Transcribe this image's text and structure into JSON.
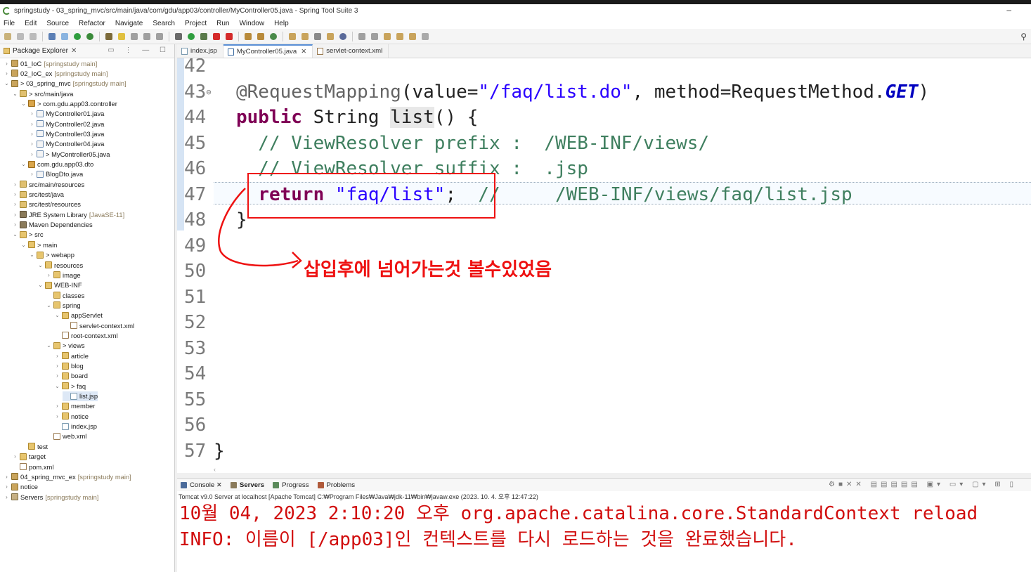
{
  "window": {
    "title": "springstudy - 03_spring_mvc/src/main/java/com/gdu/app03/controller/MyController05.java - Spring Tool Suite 3"
  },
  "menu": [
    "File",
    "Edit",
    "Source",
    "Refactor",
    "Navigate",
    "Search",
    "Project",
    "Run",
    "Window",
    "Help"
  ],
  "package_explorer": {
    "title": "Package Explorer",
    "items": [
      {
        "label": "01_IoC",
        "extra": "[springstudy main]",
        "depth": 0,
        "arrow": ">",
        "icon": "proj"
      },
      {
        "label": "02_IoC_ex",
        "extra": "[springstudy main]",
        "depth": 0,
        "arrow": ">",
        "icon": "proj"
      },
      {
        "label": "> 03_spring_mvc",
        "extra": "[springstudy main]",
        "depth": 0,
        "arrow": "v",
        "icon": "proj"
      },
      {
        "label": "> src/main/java",
        "extra": "",
        "depth": 1,
        "arrow": "v",
        "icon": "src"
      },
      {
        "label": "> com.gdu.app03.controller",
        "extra": "",
        "depth": 2,
        "arrow": "v",
        "icon": "pkg"
      },
      {
        "label": "MyController01.java",
        "extra": "",
        "depth": 3,
        "arrow": ">",
        "icon": "java"
      },
      {
        "label": "MyController02.java",
        "extra": "",
        "depth": 3,
        "arrow": ">",
        "icon": "java"
      },
      {
        "label": "MyController03.java",
        "extra": "",
        "depth": 3,
        "arrow": ">",
        "icon": "java"
      },
      {
        "label": "MyController04.java",
        "extra": "",
        "depth": 3,
        "arrow": ">",
        "icon": "java"
      },
      {
        "label": "> MyController05.java",
        "extra": "",
        "depth": 3,
        "arrow": ">",
        "icon": "java"
      },
      {
        "label": "com.gdu.app03.dto",
        "extra": "",
        "depth": 2,
        "arrow": "v",
        "icon": "pkg"
      },
      {
        "label": "BlogDto.java",
        "extra": "",
        "depth": 3,
        "arrow": ">",
        "icon": "java"
      },
      {
        "label": "src/main/resources",
        "extra": "",
        "depth": 1,
        "arrow": ">",
        "icon": "src"
      },
      {
        "label": "src/test/java",
        "extra": "",
        "depth": 1,
        "arrow": ">",
        "icon": "src"
      },
      {
        "label": "src/test/resources",
        "extra": "",
        "depth": 1,
        "arrow": ">",
        "icon": "src"
      },
      {
        "label": "JRE System Library",
        "extra": "[JavaSE-11]",
        "depth": 1,
        "arrow": ">",
        "icon": "lib"
      },
      {
        "label": "Maven Dependencies",
        "extra": "",
        "depth": 1,
        "arrow": ">",
        "icon": "lib"
      },
      {
        "label": "> src",
        "extra": "",
        "depth": 1,
        "arrow": "v",
        "icon": "folder"
      },
      {
        "label": "> main",
        "extra": "",
        "depth": 2,
        "arrow": "v",
        "icon": "folder"
      },
      {
        "label": "> webapp",
        "extra": "",
        "depth": 3,
        "arrow": "v",
        "icon": "folder"
      },
      {
        "label": "resources",
        "extra": "",
        "depth": 4,
        "arrow": "v",
        "icon": "folder"
      },
      {
        "label": "image",
        "extra": "",
        "depth": 5,
        "arrow": ">",
        "icon": "folder"
      },
      {
        "label": "WEB-INF",
        "extra": "",
        "depth": 4,
        "arrow": "v",
        "icon": "folder"
      },
      {
        "label": "classes",
        "extra": "",
        "depth": 5,
        "arrow": "",
        "icon": "folder"
      },
      {
        "label": "spring",
        "extra": "",
        "depth": 5,
        "arrow": "v",
        "icon": "folder"
      },
      {
        "label": "appServlet",
        "extra": "",
        "depth": 6,
        "arrow": "v",
        "icon": "folder"
      },
      {
        "label": "servlet-context.xml",
        "extra": "",
        "depth": 7,
        "arrow": "",
        "icon": "xml"
      },
      {
        "label": "root-context.xml",
        "extra": "",
        "depth": 6,
        "arrow": "",
        "icon": "xml"
      },
      {
        "label": "> views",
        "extra": "",
        "depth": 5,
        "arrow": "v",
        "icon": "folder"
      },
      {
        "label": "article",
        "extra": "",
        "depth": 6,
        "arrow": ">",
        "icon": "folder"
      },
      {
        "label": "blog",
        "extra": "",
        "depth": 6,
        "arrow": ">",
        "icon": "folder"
      },
      {
        "label": "board",
        "extra": "",
        "depth": 6,
        "arrow": ">",
        "icon": "folder"
      },
      {
        "label": "> faq",
        "extra": "",
        "depth": 6,
        "arrow": "v",
        "icon": "folder"
      },
      {
        "label": "list.jsp",
        "extra": "",
        "depth": 7,
        "arrow": "",
        "icon": "jsp",
        "selected": true
      },
      {
        "label": "member",
        "extra": "",
        "depth": 6,
        "arrow": ">",
        "icon": "folder"
      },
      {
        "label": "notice",
        "extra": "",
        "depth": 6,
        "arrow": ">",
        "icon": "folder"
      },
      {
        "label": "index.jsp",
        "extra": "",
        "depth": 6,
        "arrow": "",
        "icon": "jsp"
      },
      {
        "label": "web.xml",
        "extra": "",
        "depth": 5,
        "arrow": "",
        "icon": "xml"
      },
      {
        "label": "test",
        "extra": "",
        "depth": 2,
        "arrow": "",
        "icon": "folder"
      },
      {
        "label": "target",
        "extra": "",
        "depth": 1,
        "arrow": ">",
        "icon": "folder"
      },
      {
        "label": "pom.xml",
        "extra": "",
        "depth": 1,
        "arrow": "",
        "icon": "xml"
      },
      {
        "label": "04_spring_mvc_ex",
        "extra": "[springstudy main]",
        "depth": 0,
        "arrow": ">",
        "icon": "proj"
      },
      {
        "label": "notice",
        "extra": "",
        "depth": 0,
        "arrow": ">",
        "icon": "proj"
      },
      {
        "label": "Servers",
        "extra": "[springstudy main]",
        "depth": 0,
        "arrow": ">",
        "icon": "srv"
      }
    ]
  },
  "editor_tabs": [
    {
      "label": "index.jsp",
      "active": false,
      "closable": false
    },
    {
      "label": "MyController05.java",
      "active": true,
      "closable": true
    },
    {
      "label": "servlet-context.xml",
      "active": false,
      "closable": false
    }
  ],
  "code": {
    "line_numbers": [
      "42",
      "43",
      "44",
      "45",
      "46",
      "47",
      "48",
      "49",
      "50",
      "51",
      "52",
      "53",
      "54",
      "55",
      "56",
      "57"
    ],
    "line43_ann": "@RequestMapping",
    "line43_a": "(value=",
    "line43_str": "\"/faq/list.do\"",
    "line43_b": ", method=RequestMethod.",
    "line43_get": "GET",
    "line43_c": ")",
    "line44_kw": "public",
    "line44_a": " String ",
    "line44_hl": "list",
    "line44_b": "() {",
    "line45": "  // ViewResolver prefix :  /WEB-INF/views/",
    "line46": "  // ViewResolver suffix :  .jsp",
    "line47_kw": "return",
    "line47_str": "\"faq/list\"",
    "line47_semi": ";  ",
    "line47_cm": "//     /WEB-INF/views/faq/list.jsp",
    "line48": "}",
    "line57": "}"
  },
  "annotation_text": "삽입후에 넘어가는것 볼수있었음",
  "console": {
    "tabs": [
      "Console",
      "Servers",
      "Progress",
      "Problems"
    ],
    "status": "Tomcat v9.0 Server at localhost [Apache Tomcat] C:₩Program Files₩Java₩jdk-11₩bin₩javaw.exe  (2023. 10. 4. 오후 12:47:22)",
    "lines": [
      "10월 04, 2023 2:10:20 오후 org.apache.catalina.core.StandardContext reload",
      "INFO: 이름이 [/app03]인 컨텍스트를 다시 로드하는 것을 완료했습니다."
    ]
  },
  "colors": {
    "annotation": "#e11111",
    "keyword": "#7f0055",
    "string": "#2a00ff",
    "comment": "#3f7f5f"
  }
}
